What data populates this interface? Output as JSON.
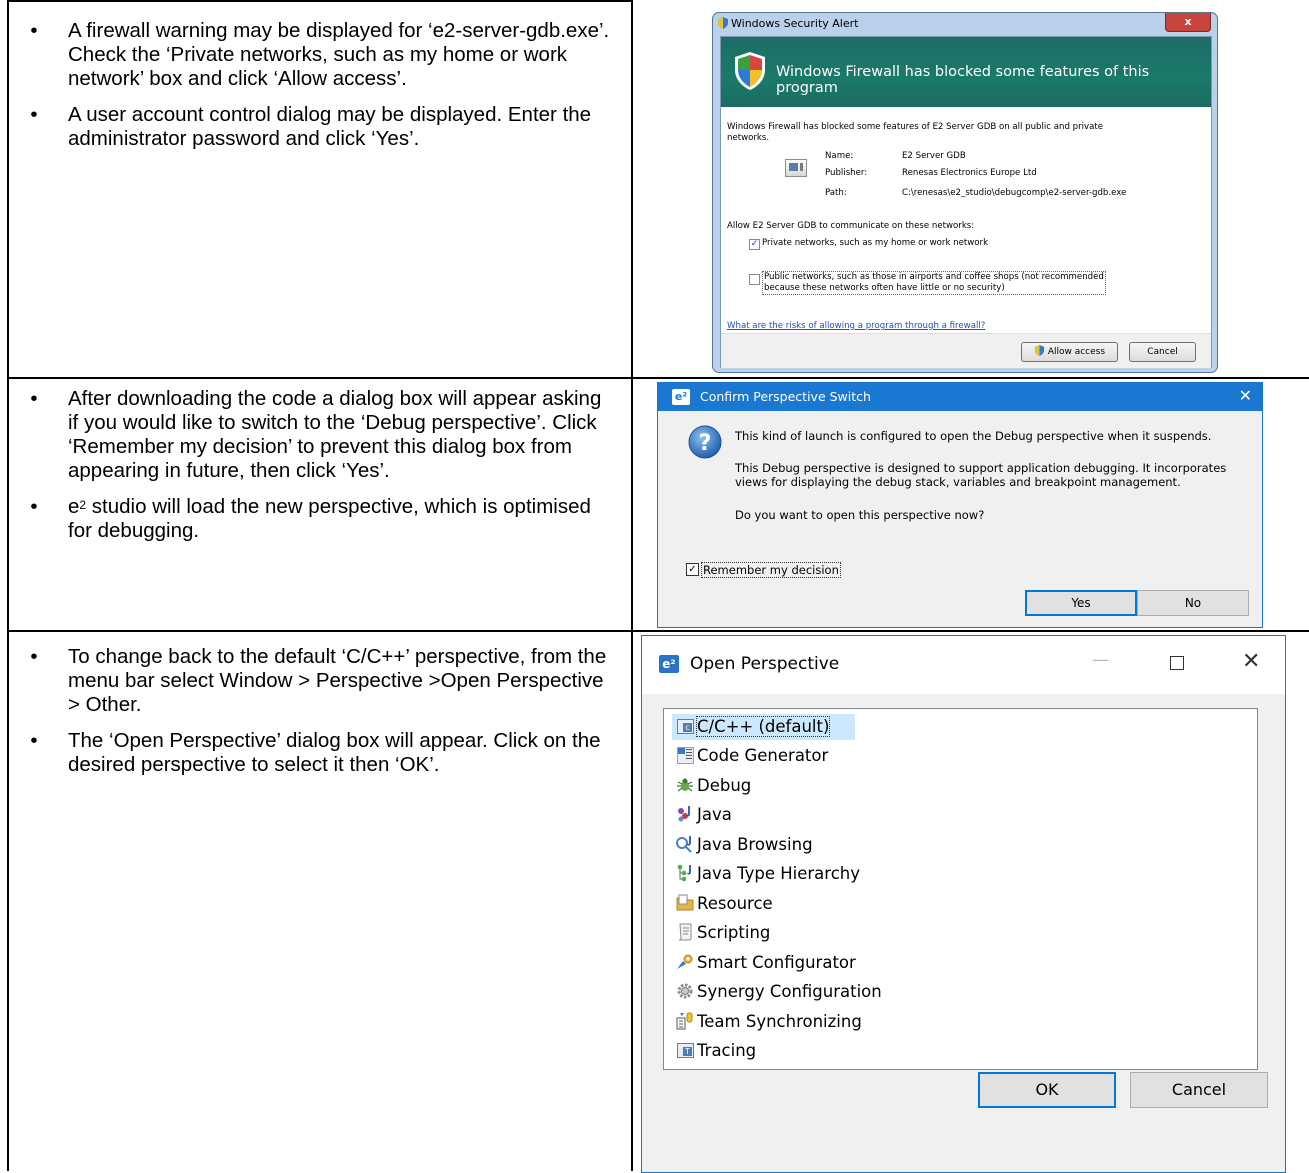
{
  "rows": [
    {
      "bullets": [
        "A firewall warning may be displayed for ‘e2-server-gdb.exe’.  Check the ‘Private networks, such as my home or work network’ box and click ‘Allow access’.",
        "A user account control dialog may be displayed. Enter the administrator password and click ‘Yes’."
      ]
    },
    {
      "bullets": [
        "After downloading the code a dialog box will appear asking if you would like to switch to the ‘Debug perspective’.  Click ‘Remember my decision’ to prevent this dialog box from appearing in future, then click ‘Yes’.",
        "studio will load the new perspective, which is optimised for debugging."
      ],
      "e2_prefix": "e",
      "e2_sup": "2"
    },
    {
      "bullets": [
        "To change back to the default ‘C/C++’ perspective, from the menu bar select Window > Perspective >Open Perspective > Other.",
        "The ‘Open Perspective’ dialog box will appear. Click on the desired perspective to select it then ‘OK’."
      ]
    }
  ],
  "firewall": {
    "window_title": "Windows Security Alert",
    "close_glyph": "x",
    "banner": "Windows Firewall has blocked some features of this program",
    "intro": "Windows Firewall has blocked some features of E2 Server GDB on all public and private networks.",
    "name_label": "Name:",
    "name_value": "E2 Server GDB",
    "publisher_label": "Publisher:",
    "publisher_value": "Renesas Electronics Europe Ltd",
    "path_label": "Path:",
    "path_value": "C:\\renesas\\e2_studio\\debugcomp\\e2-server-gdb.exe",
    "allow_text": "Allow E2 Server GDB to communicate on these networks:",
    "private_label": "Private networks, such as my home or work network",
    "private_checked": true,
    "public_label_1": "Public networks, such as those in airports and coffee shops (not recommended",
    "public_label_2": "because these networks often have little or no security)",
    "public_checked": false,
    "risk_link": "What are the risks of allowing a program through a firewall?",
    "allow_button": "Allow access",
    "cancel_button": "Cancel"
  },
  "confirm": {
    "title": "Confirm Perspective Switch",
    "close_glyph": "✕",
    "line1": "This kind of launch is configured to open the Debug perspective when it suspends.",
    "line2a": "This Debug perspective is designed to support application debugging.  It incorporates",
    "line2b": "views for displaying the debug stack, variables and breakpoint management.",
    "line3": "Do you want to open this perspective now?",
    "remember_label": "Remember my decision",
    "remember_checked": true,
    "yes_button": "Yes",
    "no_button": "No",
    "logo_text": "e²"
  },
  "open_perspective": {
    "title": "Open Perspective",
    "min_glyph": "—",
    "close_glyph": "✕",
    "items": [
      "C/C++ (default)",
      "Code Generator",
      "Debug",
      "Java",
      "Java Browsing",
      "Java Type Hierarchy",
      "Resource",
      "Scripting",
      "Smart Configurator",
      "Synergy Configuration",
      "Team Synchronizing",
      "Tracing"
    ],
    "selected_index": 0,
    "ok_button": "OK",
    "cancel_button": "Cancel",
    "logo_text": "e²"
  },
  "bullet_glyph": "•"
}
